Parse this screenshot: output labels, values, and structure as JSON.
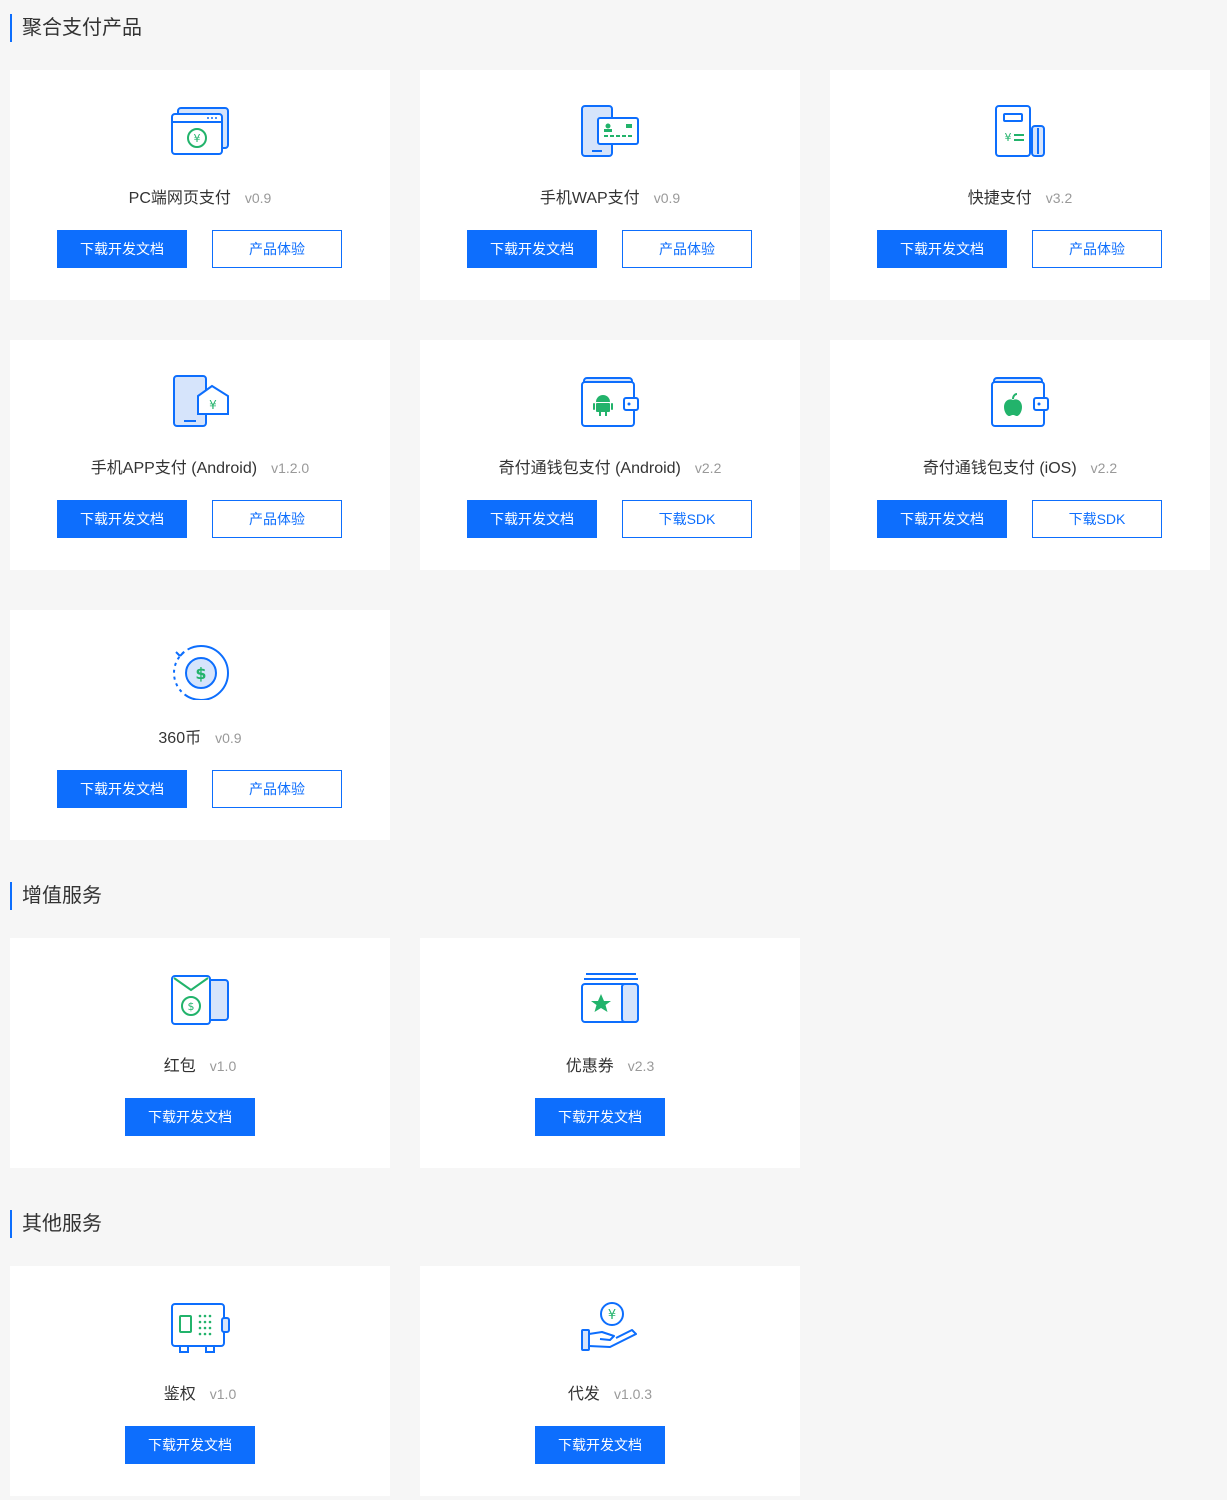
{
  "sections": [
    {
      "title": "聚合支付产品"
    },
    {
      "title": "增值服务"
    },
    {
      "title": "其他服务"
    }
  ],
  "colors": {
    "accent": "#0d6efd",
    "green": "#22b36b",
    "background": "#f6f6f6"
  },
  "aggregate": [
    {
      "name": "PC端网页支付",
      "version": "v0.9",
      "icon": "pc-web-pay-icon",
      "primary": "下载开发文档",
      "secondary": "产品体验"
    },
    {
      "name": "手机WAP支付",
      "version": "v0.9",
      "icon": "mobile-wap-pay-icon",
      "primary": "下载开发文档",
      "secondary": "产品体验"
    },
    {
      "name": "快捷支付",
      "version": "v3.2",
      "icon": "quick-pay-icon",
      "primary": "下载开发文档",
      "secondary": "产品体验"
    },
    {
      "name": "手机APP支付 (Android)",
      "version": "v1.2.0",
      "icon": "mobile-app-pay-icon",
      "primary": "下载开发文档",
      "secondary": "产品体验"
    },
    {
      "name": "奇付通钱包支付 (Android)",
      "version": "v2.2",
      "icon": "android-wallet-icon",
      "primary": "下载开发文档",
      "secondary": "下载SDK"
    },
    {
      "name": "奇付通钱包支付 (iOS)",
      "version": "v2.2",
      "icon": "ios-wallet-icon",
      "primary": "下载开发文档",
      "secondary": "下载SDK"
    },
    {
      "name": "360币",
      "version": "v0.9",
      "icon": "coin-icon",
      "primary": "下载开发文档",
      "secondary": "产品体验"
    }
  ],
  "value_added": [
    {
      "name": "红包",
      "version": "v1.0",
      "icon": "red-envelope-icon",
      "primary": "下载开发文档"
    },
    {
      "name": "优惠券",
      "version": "v2.3",
      "icon": "coupon-icon",
      "primary": "下载开发文档"
    }
  ],
  "other": [
    {
      "name": "鉴权",
      "version": "v1.0",
      "icon": "safe-auth-icon",
      "primary": "下载开发文档"
    },
    {
      "name": "代发",
      "version": "v1.0.3",
      "icon": "payout-hand-icon",
      "primary": "下载开发文档"
    }
  ]
}
